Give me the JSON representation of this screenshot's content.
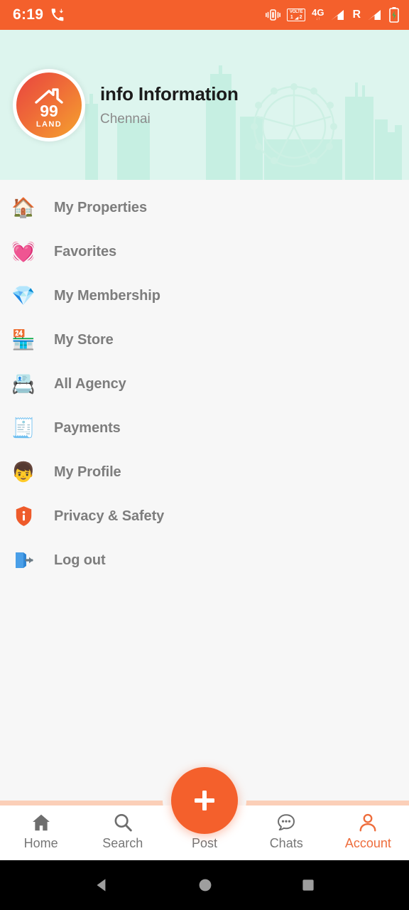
{
  "status_bar": {
    "time": "6:19",
    "call_icon": "missed-call-icon",
    "icons": [
      {
        "name": "vibrate-icon",
        "label": ""
      },
      {
        "name": "volte-dual-sim-icon",
        "label": "VOLTE",
        "sim1": "1",
        "sim2": "2"
      },
      {
        "name": "network-4g-icon",
        "label": "4G",
        "sublabel": "↓↑"
      },
      {
        "name": "signal-sim1-icon",
        "label": ""
      },
      {
        "name": "roaming-icon",
        "label": "R"
      },
      {
        "name": "signal-sim2-icon",
        "label": ""
      },
      {
        "name": "battery-charging-icon",
        "label": ""
      }
    ],
    "background_color": "#f4602c"
  },
  "header": {
    "title": "info Information",
    "subtitle": "Chennai",
    "logo": {
      "name": "99-land-logo",
      "line1": "99",
      "line2": "LAND",
      "gradient_from": "#e8443f",
      "gradient_to": "#f5a32e"
    },
    "background_color": "#ddf5ee",
    "skyline_color": "#bfeddf"
  },
  "menu": {
    "items": [
      {
        "label": "My Properties",
        "icon": "house-icon",
        "glyph": "🏠"
      },
      {
        "label": "Favorites",
        "icon": "heart-icon",
        "glyph": "💓"
      },
      {
        "label": "My Membership",
        "icon": "gem-icon",
        "glyph": "💎"
      },
      {
        "label": "My Store",
        "icon": "store-icon",
        "glyph": "🏪"
      },
      {
        "label": "All Agency",
        "icon": "card-index-icon",
        "glyph": "📇"
      },
      {
        "label": "Payments",
        "icon": "receipt-icon",
        "glyph": "🧾"
      },
      {
        "label": "My Profile",
        "icon": "person-icon",
        "glyph": "👦"
      },
      {
        "label": "Privacy & Safety",
        "icon": "shield-info-icon",
        "glyph": ""
      },
      {
        "label": "Log out",
        "icon": "logout-icon",
        "glyph": ""
      }
    ]
  },
  "bottom_nav": {
    "active": "Account",
    "accent_color": "#ee6d3c",
    "border_color": "#fbcfb8",
    "items": [
      {
        "label": "Home",
        "icon": "home-icon"
      },
      {
        "label": "Search",
        "icon": "search-icon"
      },
      {
        "label": "Post",
        "icon": "plus-icon"
      },
      {
        "label": "Chats",
        "icon": "chat-bubble-icon"
      },
      {
        "label": "Account",
        "icon": "account-person-icon"
      }
    ],
    "fab": {
      "name": "post-fab-button",
      "icon": "plus-icon",
      "color": "#f4602c"
    }
  },
  "android_nav": {
    "buttons": [
      {
        "name": "back-button",
        "icon": "triangle-left-icon"
      },
      {
        "name": "home-button",
        "icon": "circle-icon"
      },
      {
        "name": "recents-button",
        "icon": "square-icon"
      }
    ]
  }
}
